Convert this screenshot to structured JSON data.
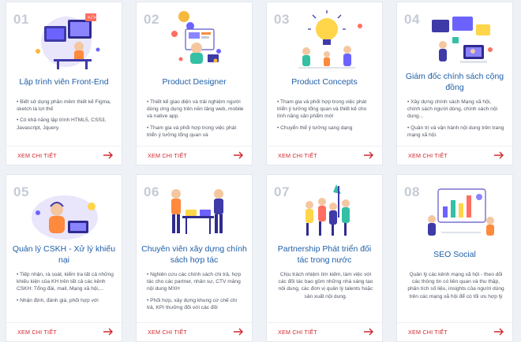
{
  "cards": [
    {
      "num": "01",
      "title": "Lập trình viên Front-End",
      "body": [
        "• Biết sử dụng phần mềm thiết kế Figma, sketch là lợi thế",
        "• Có khả năng lập trình HTML5, CSS3, Javascript, Jquery."
      ],
      "more": "XEM CHI TIẾT"
    },
    {
      "num": "02",
      "title": "Product Designer",
      "body": [
        "• Thiết kế giao diện và trải nghiệm người dùng ứng dụng trên nền tảng web, mobile và native app.",
        "• Tham gia và phối hợp trong việc phát triển ý tưởng tổng quan và"
      ],
      "more": "XEM CHI TIẾT"
    },
    {
      "num": "03",
      "title": "Product Concepts",
      "body": [
        "• Tham gia và phối hợp trong việc phát triển ý tưởng tổng quan và thiết kế cho tính năng sản phẩm mới",
        "• Chuyển thể ý tưởng sang dạng"
      ],
      "more": "XEM CHI TIẾT"
    },
    {
      "num": "04",
      "title": "Giám đốc chính sách cộng đồng",
      "body": [
        "• Xây dựng chính sách Mạng xã hội, chính sách người dùng, chính sách nội dung...",
        "• Quản trị và vận hành nội dung trên trang mạng xã hội."
      ],
      "more": "XEM CHI TIẾT"
    },
    {
      "num": "05",
      "title": "Quản lý CSKH - Xử lý khiếu nại",
      "body": [
        "• Tiếp nhận, rà soát, kiểm tra tất cả những khiếu kiện của KH trên tất cả các kênh CSKH: Tổng đài, mail, Mạng xã hội,...",
        "• Nhận định, đánh giá, phối hợp với"
      ],
      "more": "XEM CHI TIẾT"
    },
    {
      "num": "06",
      "title": "Chuyên viên xây dựng chính sách hợp tác",
      "body": [
        "• Nghiên cứu các chính sách chi trả, hợp tác cho các partner, nhân sự, CTV mảng nội dung MXH",
        "• Phối hợp, xây dựng khung cơ chế chi trả, KPI thưởng đối với các đối"
      ],
      "more": "XEM CHI TIẾT"
    },
    {
      "num": "07",
      "title": "Partnership Phát triển đối tác trong nước",
      "body": [
        "Chịu trách nhiệm tìm kiếm, làm việc với các đối tác bao gồm những nhà sáng tạo nội dung, các đơn vị quản lý talents hoặc sản xuất nội dung."
      ],
      "more": "XEM CHI TIẾT"
    },
    {
      "num": "08",
      "title": "SEO Social",
      "body": [
        "Quản lý các kênh mạng xã hội - theo dõi các thông tin có liên quan và thu thập, phân tích số liệu, insights của người dùng trên các mạng xã hội để có tối ưu hợp lý"
      ],
      "more": "XEM CHI TIẾT"
    }
  ],
  "colors": {
    "title": "#1f5fa8",
    "more": "#d0282e",
    "number": "#c5cbd6"
  }
}
